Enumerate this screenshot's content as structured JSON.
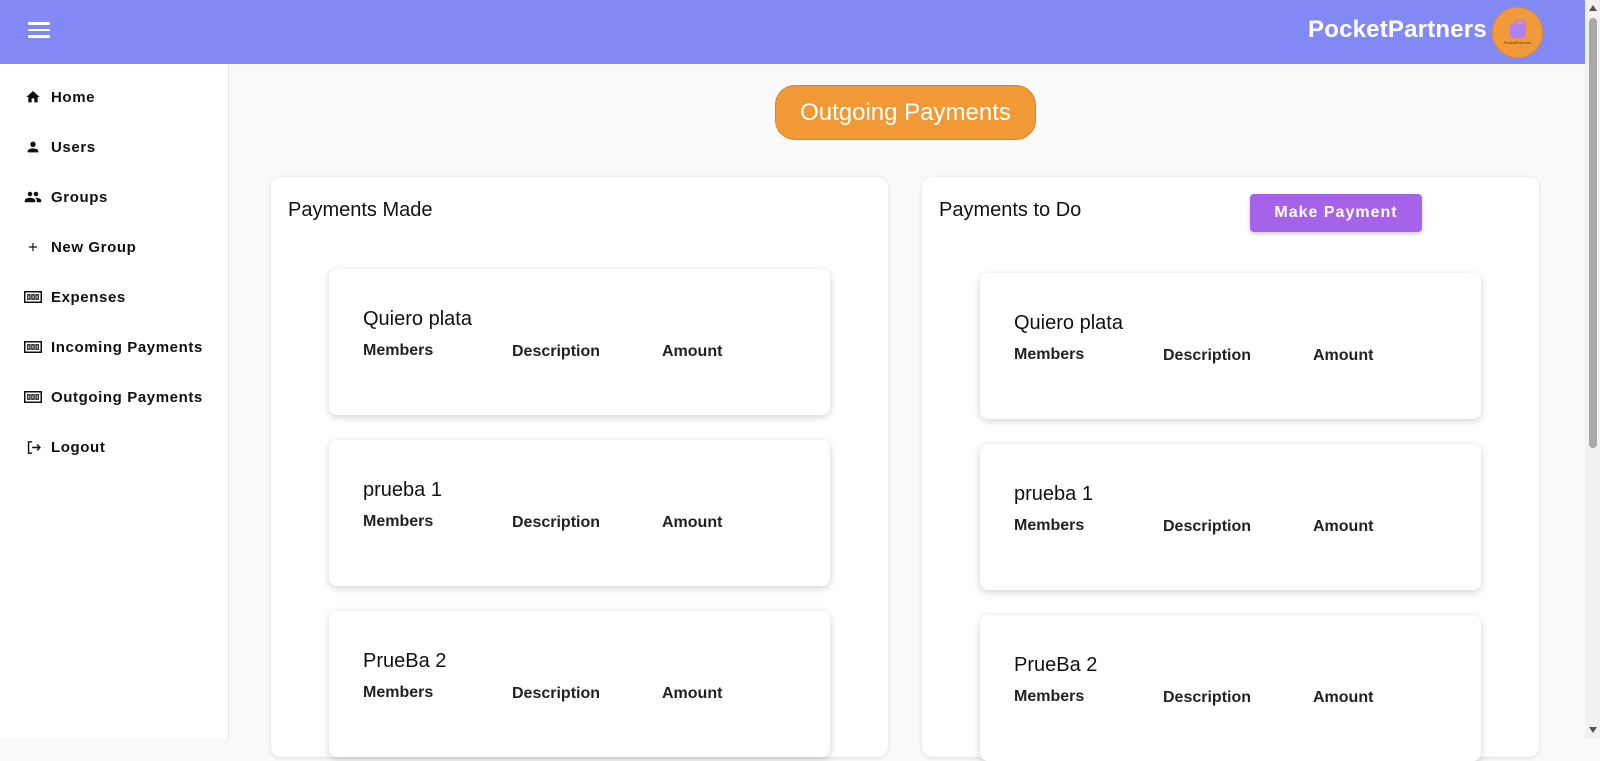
{
  "header": {
    "app_name": "PocketPartners",
    "logo_text": "PocketPartners"
  },
  "sidebar": {
    "items": [
      {
        "label": "Home",
        "icon": "home-icon"
      },
      {
        "label": "Users",
        "icon": "user-icon"
      },
      {
        "label": "Groups",
        "icon": "groups-icon"
      },
      {
        "label": "New Group",
        "icon": "plus-icon"
      },
      {
        "label": "Expenses",
        "icon": "money-icon"
      },
      {
        "label": "Incoming Payments",
        "icon": "money-icon"
      },
      {
        "label": "Outgoing Payments",
        "icon": "money-icon"
      },
      {
        "label": "Logout",
        "icon": "logout-icon"
      }
    ]
  },
  "main": {
    "page_title": "Outgoing Payments",
    "payments_made": {
      "title": "Payments Made",
      "cards": [
        {
          "title": "Quiero plata",
          "members": "Members",
          "description": "Description",
          "amount": "Amount"
        },
        {
          "title": "prueba 1",
          "members": "Members",
          "description": "Description",
          "amount": "Amount"
        },
        {
          "title": "PrueBa 2",
          "members": "Members",
          "description": "Description",
          "amount": "Amount"
        }
      ]
    },
    "payments_to_do": {
      "title": "Payments to Do",
      "action_label": "Make Payment",
      "cards": [
        {
          "title": "Quiero plata",
          "members": "Members",
          "description": "Description",
          "amount": "Amount"
        },
        {
          "title": "prueba 1",
          "members": "Members",
          "description": "Description",
          "amount": "Amount"
        },
        {
          "title": "PrueBa 2",
          "members": "Members",
          "description": "Description",
          "amount": "Amount"
        }
      ]
    }
  },
  "colors": {
    "header_bg": "#8289f5",
    "accent_orange": "#f19a35",
    "accent_purple": "#a663ea"
  }
}
